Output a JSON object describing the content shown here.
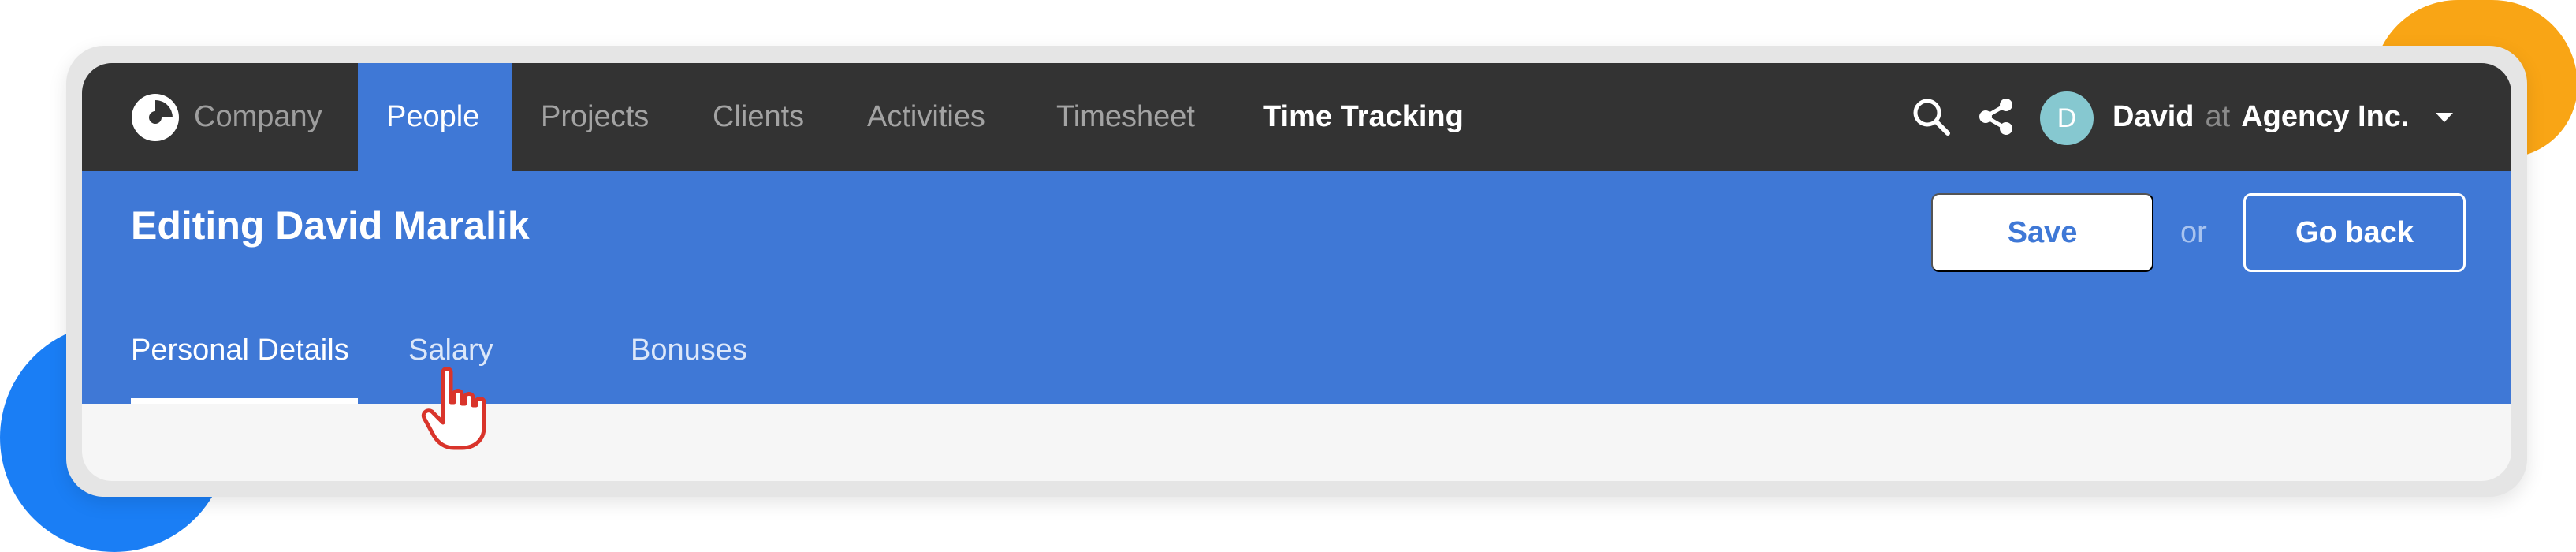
{
  "colors": {
    "nav_bg": "#333333",
    "accent_blue": "#3f78d6",
    "avatar_bg": "#86c8d0",
    "deco_orange": "#f9a515",
    "deco_blue": "#1a7ef5"
  },
  "brand": {
    "icon": "company-logo-icon",
    "name": "Company"
  },
  "nav": {
    "items": [
      {
        "label": "People",
        "active": true
      },
      {
        "label": "Projects"
      },
      {
        "label": "Clients"
      },
      {
        "label": "Activities"
      },
      {
        "label": "Timesheet"
      },
      {
        "label": "Time Tracking"
      }
    ]
  },
  "header_icons": {
    "search": "search-icon",
    "share": "share-icon"
  },
  "account": {
    "avatar_initial": "D",
    "user": "David",
    "at": "at",
    "org": "Agency Inc.",
    "caret_icon": "caret-down-icon"
  },
  "page": {
    "title": "Editing David Maralik",
    "save_label": "Save",
    "or_label": "or",
    "back_label": "Go back"
  },
  "tabs": [
    {
      "label": "Personal Details",
      "active": true
    },
    {
      "label": "Salary"
    },
    {
      "label": "Bonuses"
    }
  ],
  "cursor_icon": "hand-pointer-icon"
}
